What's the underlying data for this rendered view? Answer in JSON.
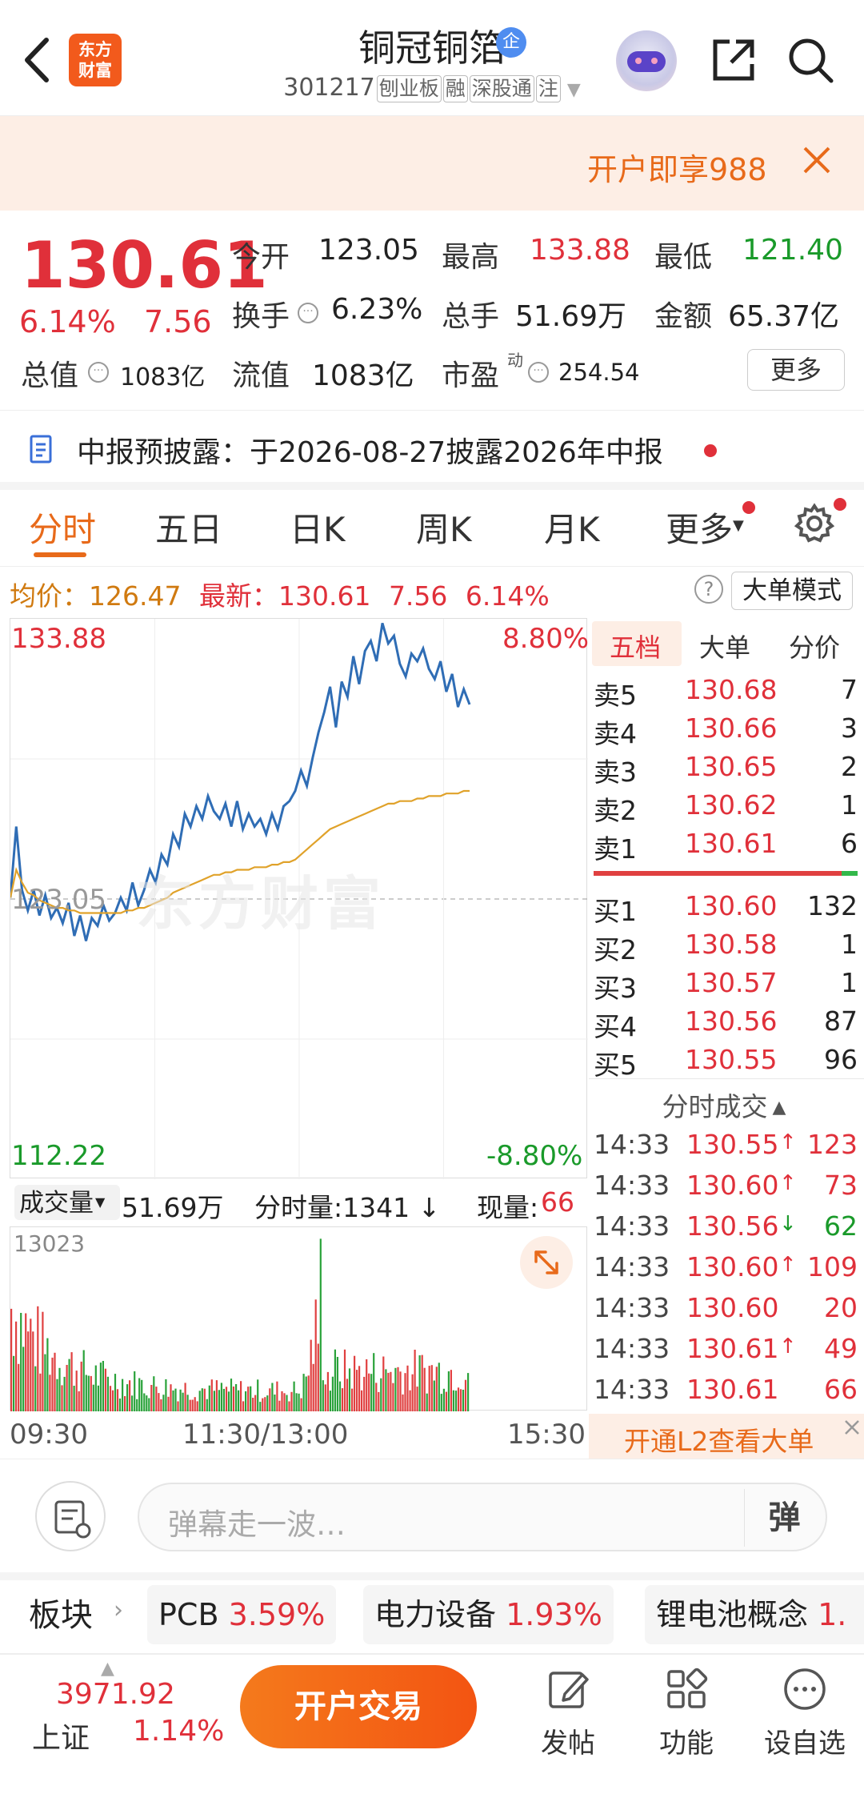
{
  "header": {
    "stock_name": "铜冠铜箔",
    "company_tag": "企",
    "code": "301217",
    "board_tags": [
      "刨业板",
      "融",
      "深股通",
      "注"
    ],
    "logo_text": "东方财富"
  },
  "promo": {
    "text": "开户即享988"
  },
  "quote": {
    "price": "130.61",
    "change_pct": "6.14%",
    "change": "7.56",
    "open_label": "今开",
    "open": "123.05",
    "high_label": "最高",
    "high": "133.88",
    "low_label": "最低",
    "low": "121.40",
    "turnover_label": "换手",
    "turnover": "6.23%",
    "volume_label": "总手",
    "volume": "51.69万",
    "amount_label": "金额",
    "amount": "65.37亿",
    "mktcap_label": "总值",
    "mktcap": "1083亿",
    "float_label": "流值",
    "float": "1083亿",
    "pe_label": "市盈",
    "pe_sup": "动",
    "pe": "254.54",
    "more_label": "更多"
  },
  "notice": {
    "text": "中报预披露：于2026-08-27披露2026年中报"
  },
  "tabs": [
    "分时",
    "五日",
    "日K",
    "周K",
    "月K",
    "更多"
  ],
  "avgrow": {
    "avg_label": "均价：",
    "avg": "126.47",
    "latest_label": "最新：",
    "latest": "130.61",
    "change": "7.56",
    "pct": "6.14%",
    "mode_label": "大单模式"
  },
  "chart_data": {
    "type": "line",
    "title": "",
    "ylim": [
      112.22,
      133.88
    ],
    "y_top_label": "133.88",
    "y_bottom_label": "112.22",
    "y_ref_label": "123.05",
    "pct_top_label": "8.80%",
    "pct_bottom_label": "-8.80%",
    "x_labels": [
      "09:30",
      "11:30/13:00",
      "15:30"
    ],
    "series": [
      {
        "values": [
          123.1,
          125.9,
          123.4,
          122.6,
          123.4,
          122.4,
          123.2,
          122.3,
          122.7,
          122.1,
          122.9,
          121.6,
          122.4,
          121.4,
          122.3,
          122.0,
          122.8,
          122.2,
          122.5,
          123.1,
          122.6,
          123.7,
          122.8,
          123.4,
          124.2,
          123.7,
          124.8,
          124.4,
          125.6,
          125.1,
          126.4,
          125.9,
          126.7,
          126.2,
          127.1,
          126.5,
          126.2,
          126.8,
          125.9,
          126.9,
          125.8,
          126.4,
          125.9,
          126.2,
          125.6,
          126.4,
          125.8,
          126.7,
          126.9,
          127.3,
          128.1,
          127.5,
          128.6,
          129.6,
          130.4,
          131.4,
          129.8,
          131.6,
          131.0,
          132.6,
          131.5,
          132.8,
          133.2,
          132.4,
          133.9,
          133.1,
          133.4,
          132.3,
          131.8,
          132.7,
          132.4,
          132.9,
          132.1,
          131.7,
          132.4,
          131.2,
          131.9,
          130.6,
          131.3,
          130.7
        ]
      },
      {
        "values": [
          123.1,
          124.2,
          123.7,
          123.3,
          123.2,
          123.0,
          122.9,
          122.8,
          122.7,
          122.7,
          122.6,
          122.6,
          122.5,
          122.5,
          122.5,
          122.5,
          122.5,
          122.5,
          122.5,
          122.5,
          122.6,
          122.6,
          122.7,
          122.7,
          122.8,
          122.9,
          123.0,
          123.1,
          123.3,
          123.4,
          123.5,
          123.6,
          123.7,
          123.8,
          123.9,
          124.0,
          124.0,
          124.1,
          124.1,
          124.2,
          124.2,
          124.2,
          124.3,
          124.3,
          124.3,
          124.4,
          124.4,
          124.5,
          124.5,
          124.6,
          124.8,
          125.0,
          125.2,
          125.4,
          125.6,
          125.8,
          125.9,
          126.0,
          126.1,
          126.2,
          126.3,
          126.4,
          126.5,
          126.6,
          126.7,
          126.8,
          126.8,
          126.9,
          126.9,
          126.9,
          127.0,
          127.0,
          127.1,
          127.1,
          127.1,
          127.2,
          127.2,
          127.2,
          127.3,
          127.3
        ]
      }
    ]
  },
  "volume_bar": {
    "selector": "成交量",
    "total": "51.69万",
    "tick_label": "分时量:1341",
    "current_label": "现量:",
    "current": "66",
    "max_label": "13023"
  },
  "orderbook": {
    "tabs": [
      "五档",
      "大单",
      "分价"
    ],
    "sell": [
      {
        "label": "卖5",
        "price": "130.68",
        "vol": "7"
      },
      {
        "label": "卖4",
        "price": "130.66",
        "vol": "3"
      },
      {
        "label": "卖3",
        "price": "130.65",
        "vol": "2"
      },
      {
        "label": "卖2",
        "price": "130.62",
        "vol": "1"
      },
      {
        "label": "卖1",
        "price": "130.61",
        "vol": "6"
      }
    ],
    "buy": [
      {
        "label": "买1",
        "price": "130.60",
        "vol": "132"
      },
      {
        "label": "买2",
        "price": "130.58",
        "vol": "1"
      },
      {
        "label": "买3",
        "price": "130.57",
        "vol": "1"
      },
      {
        "label": "买4",
        "price": "130.56",
        "vol": "87"
      },
      {
        "label": "买5",
        "price": "130.55",
        "vol": "96"
      }
    ]
  },
  "trades": {
    "title": "分时成交",
    "rows": [
      {
        "time": "14:33",
        "price": "130.55",
        "dir": "↑",
        "vol": "123"
      },
      {
        "time": "14:33",
        "price": "130.60",
        "dir": "↑",
        "vol": "73"
      },
      {
        "time": "14:33",
        "price": "130.56",
        "dir": "↓",
        "vol": "62"
      },
      {
        "time": "14:33",
        "price": "130.60",
        "dir": "↑",
        "vol": "109"
      },
      {
        "time": "14:33",
        "price": "130.60",
        "dir": "",
        "vol": "20"
      },
      {
        "time": "14:33",
        "price": "130.61",
        "dir": "↑",
        "vol": "49"
      },
      {
        "time": "14:33",
        "price": "130.61",
        "dir": "",
        "vol": "66"
      }
    ],
    "l2_label": "开通L2查看大单"
  },
  "danmaku": {
    "placeholder": "弹幕走一波…",
    "button": "弹"
  },
  "sectors": {
    "title": "板块",
    "items": [
      {
        "name": "PCB",
        "pct": "3.59%"
      },
      {
        "name": "电力设备",
        "pct": "1.93%"
      },
      {
        "name": "锂电池概念",
        "pct": "1."
      }
    ]
  },
  "bottom": {
    "index_value": "3971.92",
    "index_name": "上证",
    "index_pct": "1.14%",
    "trade_label": "开户交易",
    "post_label": "发帖",
    "func_label": "功能",
    "watch_label": "设自选"
  },
  "colors": {
    "up": "#e0303a",
    "down": "#1a9a2a",
    "accent": "#e86a1a",
    "price_line": "#2f6db5",
    "avg_line": "#e0a22a"
  }
}
